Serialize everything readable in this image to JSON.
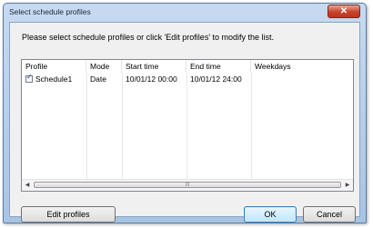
{
  "window": {
    "title": "Select schedule profiles",
    "close_symbol": "✕"
  },
  "instruction": "Please select schedule profiles or click 'Edit profiles' to modify the list.",
  "table": {
    "columns": [
      "Profile",
      "Mode",
      "Start time",
      "End time",
      "Weekdays"
    ],
    "rows": [
      {
        "checked": true,
        "profile": "Schedule1",
        "mode": "Date",
        "start_time": "10/01/12 00:00",
        "end_time": "10/01/12 24:00",
        "weekdays": ""
      }
    ],
    "scroll_left_symbol": "◀",
    "scroll_right_symbol": "▶",
    "thumb_grip": "|||"
  },
  "buttons": {
    "edit_profiles": "Edit profiles",
    "ok": "OK",
    "cancel": "Cancel"
  },
  "icons": {
    "check": "✓"
  }
}
